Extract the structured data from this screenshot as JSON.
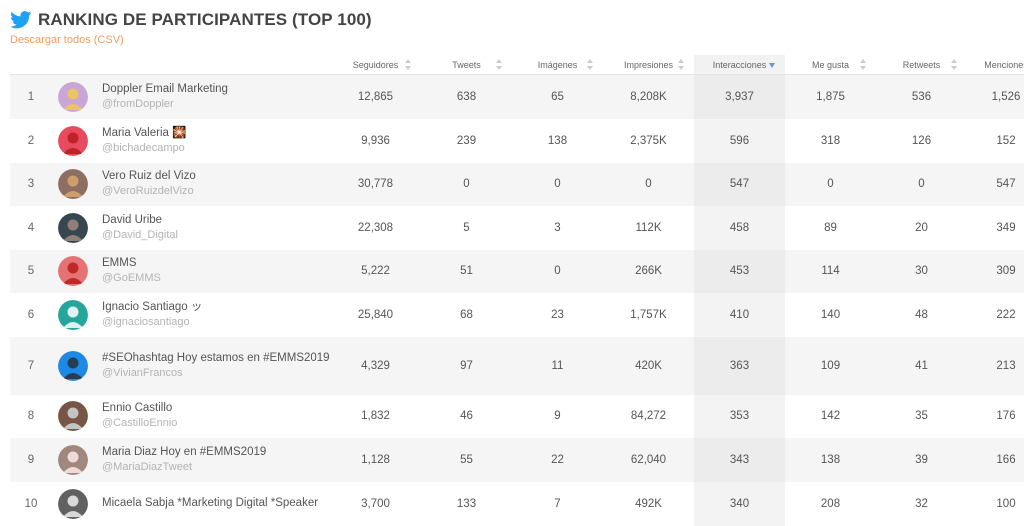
{
  "page": {
    "title": "RANKING DE PARTICIPANTES (TOP 100)",
    "csv_link": "Descargar todos (CSV)",
    "icon": "twitter-bird-icon",
    "accent": "#1da1f2",
    "link_color": "#f39c5a"
  },
  "columns": [
    "Seguidores",
    "Tweets",
    "Imágenes",
    "Impresiones",
    "Interacciones",
    "Me gusta",
    "Retweets",
    "Menciones"
  ],
  "sorted_column": "Interacciones",
  "rows": [
    {
      "rank": "1",
      "name": "Doppler Email Marketing",
      "handle": "@fromDoppler",
      "seguidores": "12,865",
      "tweets": "638",
      "imagenes": "65",
      "impresiones": "8,208K",
      "interacciones": "3,937",
      "megusta": "1,875",
      "retweets": "536",
      "menciones": "1,526"
    },
    {
      "rank": "2",
      "name": "Maria Valeria 🎇",
      "handle": "@bichadecampo",
      "seguidores": "9,936",
      "tweets": "239",
      "imagenes": "138",
      "impresiones": "2,375K",
      "interacciones": "596",
      "megusta": "318",
      "retweets": "126",
      "menciones": "152"
    },
    {
      "rank": "3",
      "name": "Vero Ruiz del Vizo",
      "handle": "@VeroRuizdelVizo",
      "seguidores": "30,778",
      "tweets": "0",
      "imagenes": "0",
      "impresiones": "0",
      "interacciones": "547",
      "megusta": "0",
      "retweets": "0",
      "menciones": "547"
    },
    {
      "rank": "4",
      "name": "David Uribe",
      "handle": "@David_Digital",
      "seguidores": "22,308",
      "tweets": "5",
      "imagenes": "3",
      "impresiones": "112K",
      "interacciones": "458",
      "megusta": "89",
      "retweets": "20",
      "menciones": "349"
    },
    {
      "rank": "5",
      "name": "EMMS",
      "handle": "@GoEMMS",
      "seguidores": "5,222",
      "tweets": "51",
      "imagenes": "0",
      "impresiones": "266K",
      "interacciones": "453",
      "megusta": "114",
      "retweets": "30",
      "menciones": "309"
    },
    {
      "rank": "6",
      "name": "Ignacio Santiago ッ",
      "handle": "@ignaciosantiago",
      "seguidores": "25,840",
      "tweets": "68",
      "imagenes": "23",
      "impresiones": "1,757K",
      "interacciones": "410",
      "megusta": "140",
      "retweets": "48",
      "menciones": "222"
    },
    {
      "rank": "7",
      "name": "#SEOhashtag Hoy estamos en #EMMS2019",
      "handle": "@VivianFrancos",
      "seguidores": "4,329",
      "tweets": "97",
      "imagenes": "11",
      "impresiones": "420K",
      "interacciones": "363",
      "megusta": "109",
      "retweets": "41",
      "menciones": "213"
    },
    {
      "rank": "8",
      "name": "Ennio Castillo",
      "handle": "@CastilloEnnio",
      "seguidores": "1,832",
      "tweets": "46",
      "imagenes": "9",
      "impresiones": "84,272",
      "interacciones": "353",
      "megusta": "142",
      "retweets": "35",
      "menciones": "176"
    },
    {
      "rank": "9",
      "name": "Maria Diaz Hoy en #EMMS2019",
      "handle": "@MariaDiazTweet",
      "seguidores": "1,128",
      "tweets": "55",
      "imagenes": "22",
      "impresiones": "62,040",
      "interacciones": "343",
      "megusta": "138",
      "retweets": "39",
      "menciones": "166"
    },
    {
      "rank": "10",
      "name": "Micaela Sabja *Marketing Digital *Speaker",
      "handle": "",
      "seguidores": "3,700",
      "tweets": "133",
      "imagenes": "7",
      "impresiones": "492K",
      "interacciones": "340",
      "megusta": "208",
      "retweets": "32",
      "menciones": "100"
    }
  ]
}
